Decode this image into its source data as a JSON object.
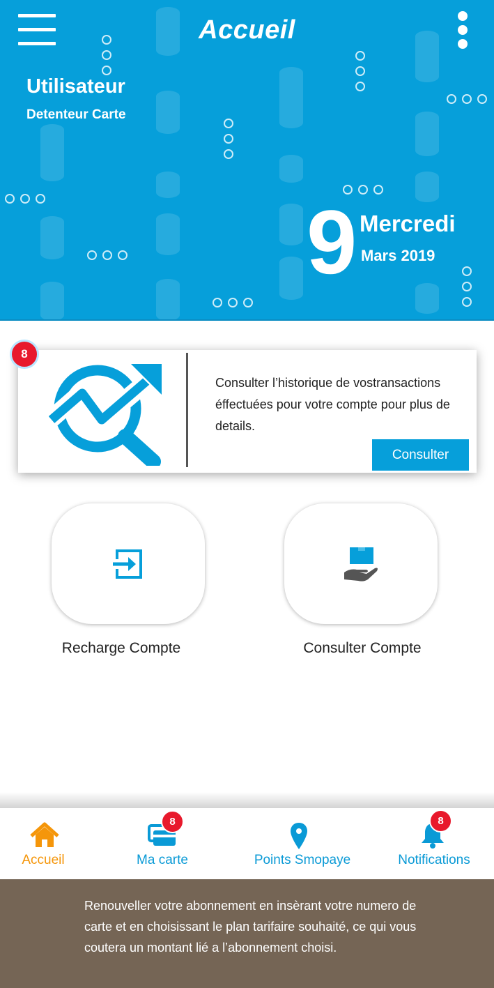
{
  "header": {
    "title": "Accueil",
    "user_name": "Utilisateur",
    "user_role": "Detenteur Carte",
    "date": {
      "day": "9",
      "weekday": "Mercredi",
      "month_year": "Mars 2019"
    }
  },
  "history_card": {
    "badge": "8",
    "description": "Consulter l’historique de vostransactions éffectuées pour votre compte pour plus de details.",
    "button_label": "Consulter"
  },
  "actions": [
    {
      "label": "Recharge Compte",
      "icon": "login-icon"
    },
    {
      "label": "Consulter Compte",
      "icon": "hand-box-icon"
    }
  ],
  "bottom_nav": [
    {
      "label": "Accueil",
      "icon": "home-icon",
      "active": true,
      "badge": null
    },
    {
      "label": "Ma carte",
      "icon": "card-icon",
      "active": false,
      "badge": "8"
    },
    {
      "label": "Points Smopaye",
      "icon": "location-pin-icon",
      "active": false,
      "badge": null
    },
    {
      "label": "Notifications",
      "icon": "bell-icon",
      "active": false,
      "badge": "8"
    }
  ],
  "footer": {
    "text": "Renouveller votre abonnement en insèrant votre numero de carte et en choisissant le plan tarifaire souhaité, ce qui vous coutera un montant lié a l’abonnement choisi."
  },
  "colors": {
    "primary": "#069fda",
    "active_nav": "#f5960a",
    "badge": "#e8192c",
    "footer": "#756555"
  }
}
